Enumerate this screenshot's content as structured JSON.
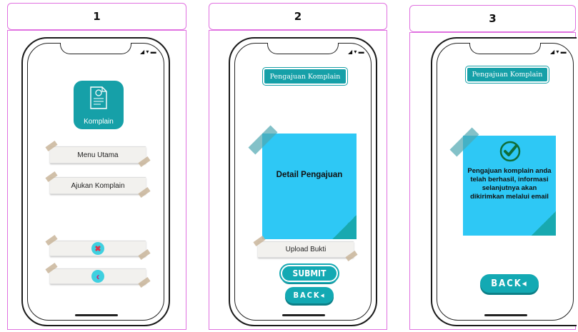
{
  "panels": [
    {
      "number": "1"
    },
    {
      "number": "2"
    },
    {
      "number": "3"
    }
  ],
  "screen1": {
    "app_icon_label": "Komplain",
    "menu_utama": "Menu Utama",
    "ajukan_komplain": "Ajukan Komplain",
    "close_glyph": "✖",
    "back_glyph": "‹"
  },
  "screen2": {
    "title": "Pengajuan Komplain",
    "note_text": "Detail Pengajuan",
    "upload_label": "Upload Bukti",
    "submit_label": "SUBMIT",
    "back_label": "BACK◂"
  },
  "screen3": {
    "title": "Pengajuan Komplain",
    "note_text": "Pengajuan komplain anda telah berhasil, informasi selanjutnya akan dikirimkan melalui email",
    "back_label": "BACK◂"
  },
  "colors": {
    "teal": "#16a0a8",
    "note_blue": "#2ec8f5",
    "panel_border": "#e070e0"
  }
}
